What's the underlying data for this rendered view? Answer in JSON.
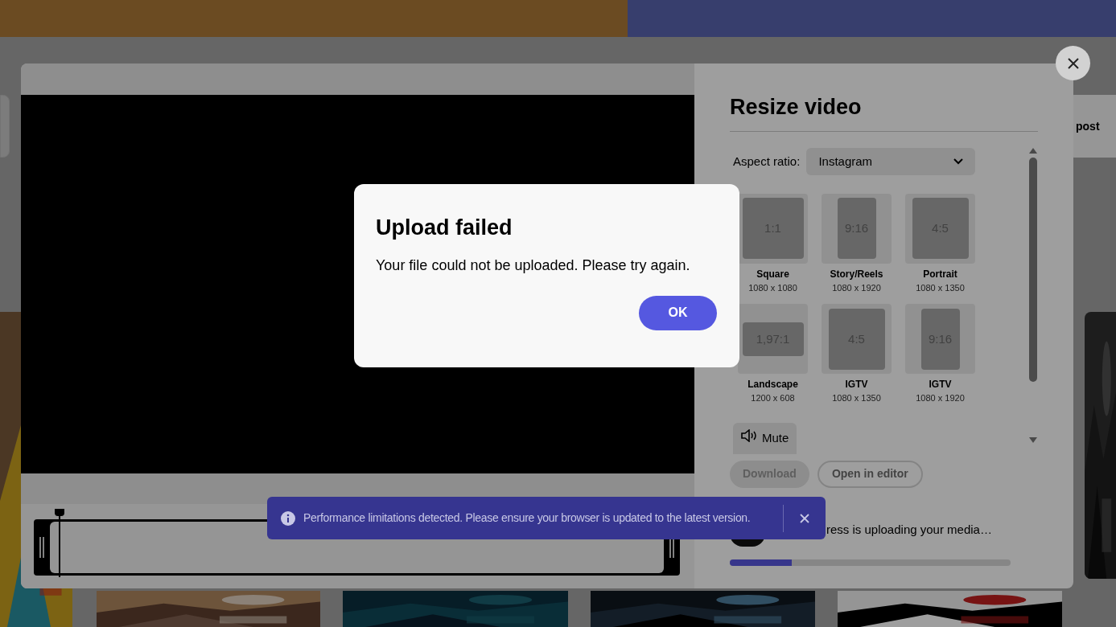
{
  "background": {
    "card_text": "post"
  },
  "resize_panel": {
    "title": "Resize video",
    "aspect_label": "Aspect ratio:",
    "aspect_value": "Instagram",
    "presets": [
      {
        "ratio": "1:1",
        "name": "Square",
        "size": "1080 x 1080",
        "kind": "square"
      },
      {
        "ratio": "9:16",
        "name": "Story/Reels",
        "size": "1080 x 1920",
        "kind": "vertical"
      },
      {
        "ratio": "4:5",
        "name": "Portrait",
        "size": "1080 x 1350",
        "kind": "portrait"
      },
      {
        "ratio": "1,97:1",
        "name": "Landscape",
        "size": "1200 x 608",
        "kind": "landscape"
      },
      {
        "ratio": "4:5",
        "name": "IGTV",
        "size": "1080 x 1350",
        "kind": "portrait"
      },
      {
        "ratio": "9:16",
        "name": "IGTV",
        "size": "1080 x 1920",
        "kind": "vertical"
      }
    ],
    "mute_label": "Mute",
    "actions": [
      {
        "label": "Download",
        "disabled": true,
        "kind": "filled"
      },
      {
        "label": "Open in editor",
        "disabled": false,
        "kind": "outline"
      }
    ],
    "upload_text": "ress is uploading your media…",
    "upload_progress": {
      "level": 0.22
    }
  },
  "toast": {
    "message": "Performance limitations detected. Please ensure your browser is updated to the latest version."
  },
  "dialog": {
    "title": "Upload failed",
    "message": "Your file could not be uploaded. Please try again.",
    "button": "OK"
  }
}
